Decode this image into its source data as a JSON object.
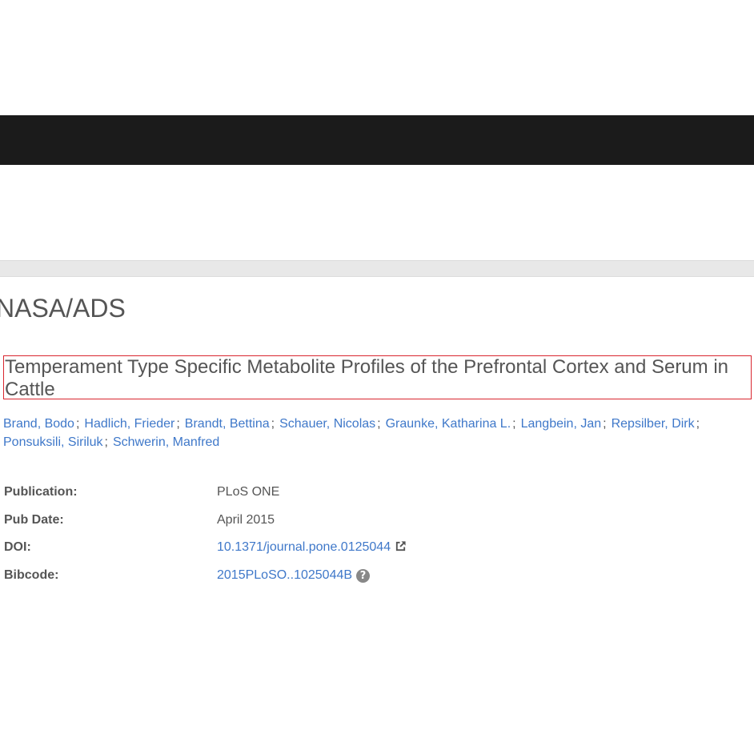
{
  "header": {
    "site_title": "NASA/ADS"
  },
  "article": {
    "title": "Temperament Type Specific Metabolite Profiles of the Prefrontal Cortex and Serum in Cattle",
    "authors": [
      "Brand, Bodo",
      "Hadlich, Frieder",
      "Brandt, Bettina",
      "Schauer, Nicolas",
      "Graunke, Katharina L.",
      "Langbein, Jan",
      "Repsilber, Dirk",
      "Ponsuksili, Siriluk",
      "Schwerin, Manfred"
    ],
    "author_separator": ";"
  },
  "metadata": {
    "publication_label": "Publication:",
    "publication_value": "PLoS ONE",
    "pubdate_label": "Pub Date:",
    "pubdate_value": "April 2015",
    "doi_label": "DOI:",
    "doi_value": "10.1371/journal.pone.0125044",
    "bibcode_label": "Bibcode:",
    "bibcode_value": "2015PLoSO..1025044B"
  },
  "icons": {
    "doi_link_icon": "external-link-icon",
    "bibcode_help_icon": "question-circle-icon",
    "help_glyph": "?"
  },
  "colors": {
    "navbar": "#1b1b1b",
    "link": "#3f78c9",
    "text": "#555555",
    "title_highlight_border": "#d9262f"
  }
}
